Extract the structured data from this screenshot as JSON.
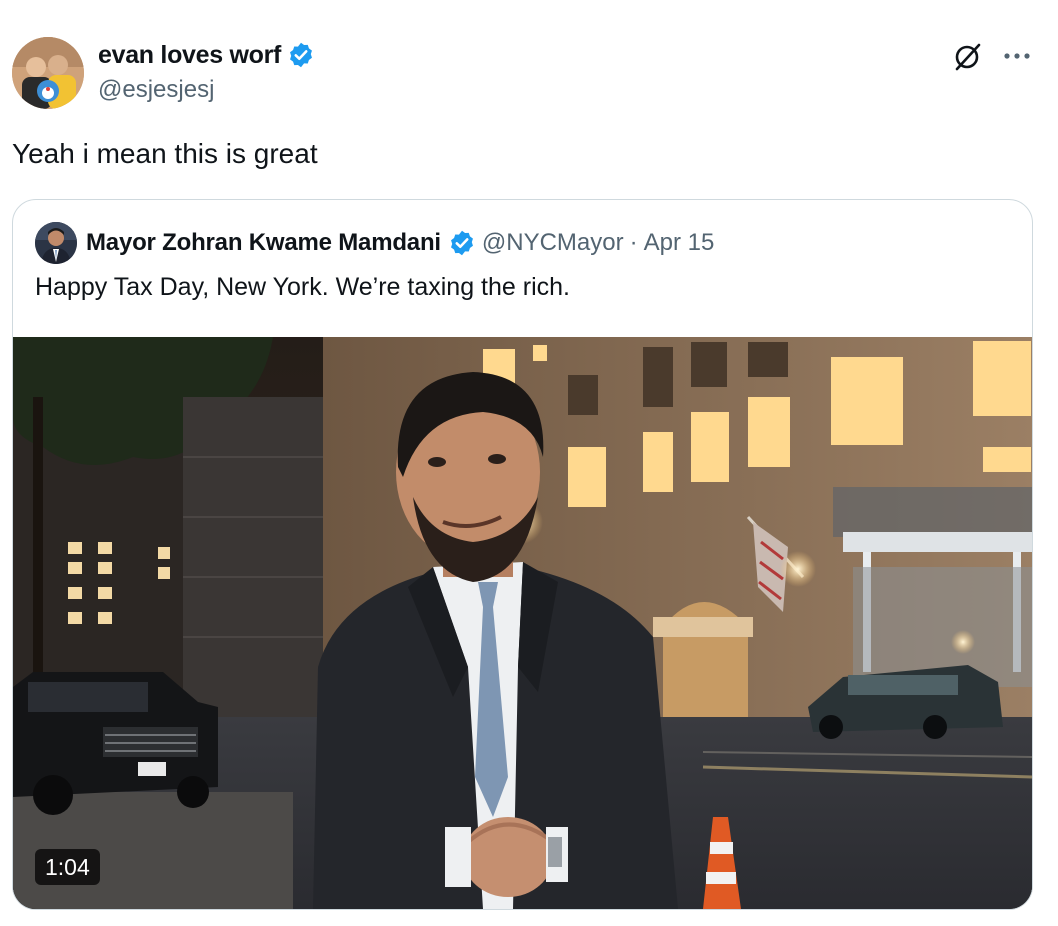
{
  "post": {
    "author_name": "evan loves worf",
    "author_handle": "@esjesjesj",
    "text": "Yeah i mean this is great",
    "icons": [
      "grok-icon",
      "more-icon",
      "verified-badge-icon"
    ]
  },
  "quoted_post": {
    "author_name": "Mayor Zohran Kwame Mamdani",
    "author_handle": "@NYCMayor",
    "separator": "·",
    "date": "Apr 15",
    "text": "Happy Tax Day, New York. We’re taxing the rich.",
    "video": {
      "duration": "1:04"
    }
  },
  "colors": {
    "verified_blue": "#1d9bf0",
    "secondary_text": "#536471",
    "border": "#cfd9de"
  }
}
